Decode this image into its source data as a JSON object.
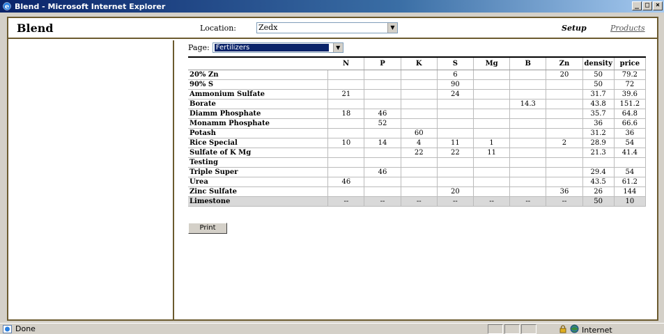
{
  "window": {
    "title": "Blend - Microsoft Internet Explorer",
    "buttons": [
      "_",
      "□",
      "×"
    ]
  },
  "header": {
    "brand": "Blend",
    "location_label": "Location:",
    "location_value": "Zedx",
    "setup_link": "Setup",
    "products_link": "Products"
  },
  "page": {
    "label": "Page:",
    "selected": "Fertilizers"
  },
  "table": {
    "columns": [
      "",
      "N",
      "P",
      "K",
      "S",
      "Mg",
      "B",
      "Zn",
      "density",
      "price"
    ],
    "rows": [
      [
        "20% Zn",
        "",
        "",
        "",
        "6",
        "",
        "",
        "20",
        "50",
        "79.2"
      ],
      [
        "90% S",
        "",
        "",
        "",
        "90",
        "",
        "",
        "",
        "50",
        "72"
      ],
      [
        "Ammonium Sulfate",
        "21",
        "",
        "",
        "24",
        "",
        "",
        "",
        "31.7",
        "39.6"
      ],
      [
        "Borate",
        "",
        "",
        "",
        "",
        "",
        "14.3",
        "",
        "43.8",
        "151.2"
      ],
      [
        "Diamm Phosphate",
        "18",
        "46",
        "",
        "",
        "",
        "",
        "",
        "35.7",
        "64.8"
      ],
      [
        "Monamm Phosphate",
        "",
        "52",
        "",
        "",
        "",
        "",
        "",
        "36",
        "66.6"
      ],
      [
        "Potash",
        "",
        "",
        "60",
        "",
        "",
        "",
        "",
        "31.2",
        "36"
      ],
      [
        "Rice Special",
        "10",
        "14",
        "4",
        "11",
        "1",
        "",
        "2",
        "28.9",
        "54"
      ],
      [
        "Sulfate of K Mg",
        "",
        "",
        "22",
        "22",
        "11",
        "",
        "",
        "21.3",
        "41.4"
      ],
      [
        "Testing",
        "",
        "",
        "",
        "",
        "",
        "",
        "",
        "",
        ""
      ],
      [
        "Triple Super",
        "",
        "46",
        "",
        "",
        "",
        "",
        "",
        "29.4",
        "54"
      ],
      [
        "Urea",
        "46",
        "",
        "",
        "",
        "",
        "",
        "",
        "43.5",
        "61.2"
      ],
      [
        "Zinc Sulfate",
        "",
        "",
        "",
        "20",
        "",
        "",
        "36",
        "26",
        "144"
      ],
      [
        "Limestone",
        "--",
        "--",
        "--",
        "--",
        "--",
        "--",
        "--",
        "50",
        "10"
      ]
    ]
  },
  "print_label": "Print",
  "status": {
    "text": "Done",
    "zone": "Internet"
  },
  "colors": {
    "frame_border": "#6b5a2e",
    "titlebar": "#0a246a",
    "shaded_row": "#d9d9d9"
  }
}
